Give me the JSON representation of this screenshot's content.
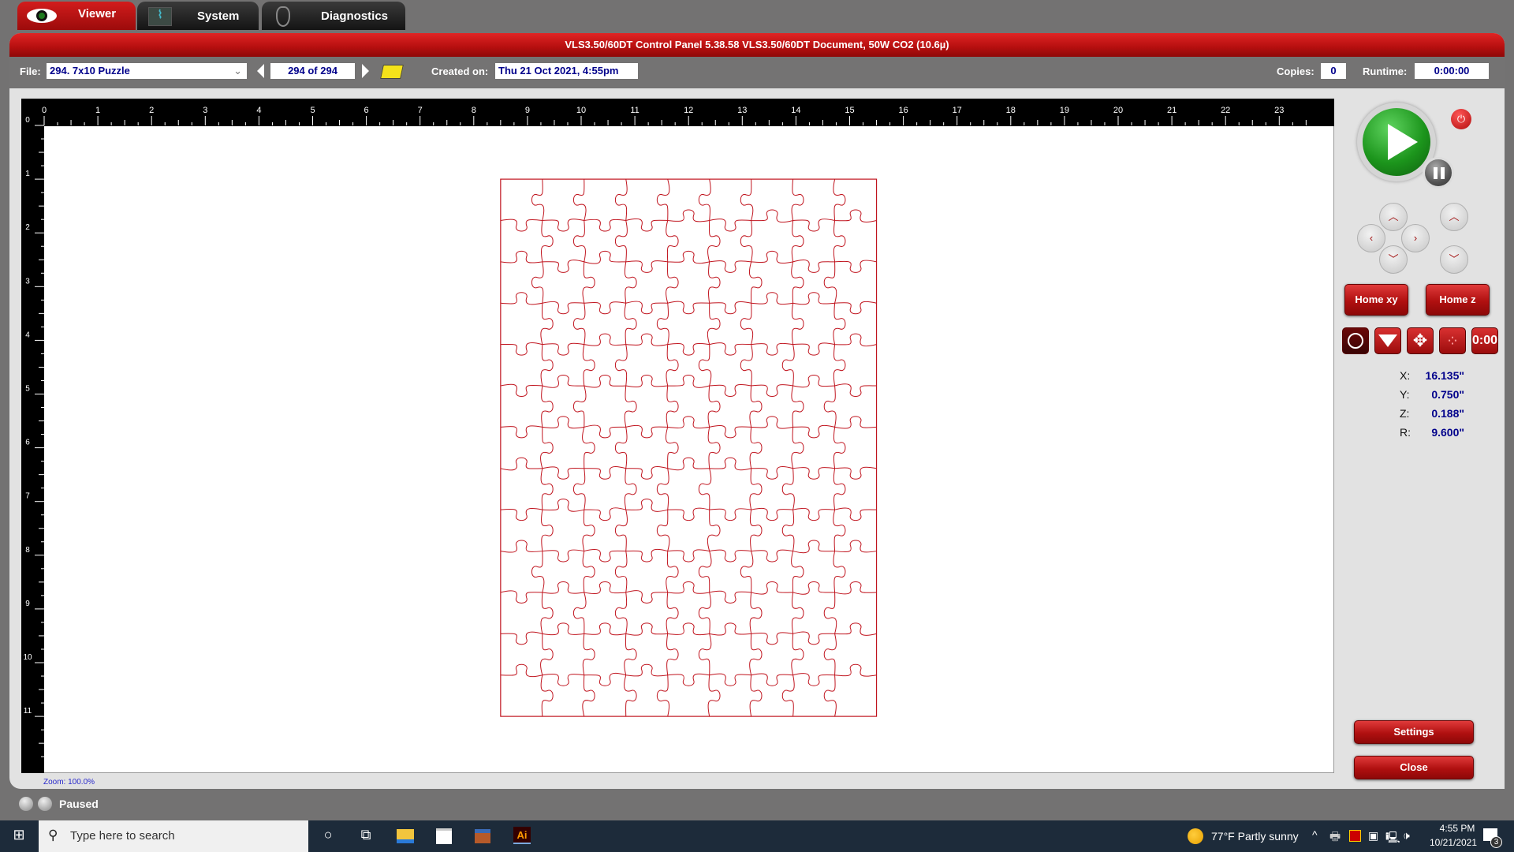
{
  "tabs": [
    {
      "label": "Viewer",
      "icon": "eye-icon",
      "active": true
    },
    {
      "label": "System",
      "icon": "waveform-icon"
    },
    {
      "label": "Diagnostics",
      "icon": "stethoscope-icon"
    }
  ],
  "title": "VLS3.50/60DT  Control Panel   5.38.58     VLS3.50/60DT Document, 50W CO2 (10.6µ)",
  "toolbar": {
    "file_label": "File:",
    "file_value": "294. 7x10 Puzzle",
    "page_value": "294 of 294",
    "created_label": "Created on:",
    "created_value": "Thu 21 Oct 2021,  4:55pm",
    "copies_label": "Copies:",
    "copies_value": "0",
    "runtime_label": "Runtime:",
    "runtime_value": "0:00:00"
  },
  "ruler": {
    "x_labels": [
      "0",
      "1",
      "2",
      "3",
      "4",
      "5",
      "6",
      "7",
      "8",
      "9",
      "10",
      "11",
      "12",
      "13",
      "14",
      "15",
      "16",
      "17",
      "18",
      "19",
      "20",
      "21",
      "22",
      "23"
    ],
    "y_labels": [
      "0",
      "1",
      "2",
      "3",
      "4",
      "5",
      "6",
      "7",
      "8",
      "9",
      "10",
      "11"
    ],
    "unit": "inch"
  },
  "document": {
    "width_in": 7,
    "height_in": 10,
    "origin_in": [
      8.5,
      1.0
    ],
    "columns": 9,
    "rows": 13,
    "line_color": "#c0141e"
  },
  "zoom_label": "Zoom:  100.0%",
  "panel": {
    "home_xy": "Home xy",
    "home_z": "Home z",
    "timer_icon_text": "0:00",
    "settings": "Settings",
    "close": "Close",
    "coords": [
      {
        "label": "X:",
        "value": "16.135\""
      },
      {
        "label": "Y:",
        "value": "0.750\""
      },
      {
        "label": "Z:",
        "value": "0.188\""
      },
      {
        "label": "R:",
        "value": "9.600\""
      }
    ]
  },
  "status": "Paused",
  "taskbar": {
    "search_placeholder": "Type here to search",
    "weather": "77°F  Partly sunny",
    "time": "4:55 PM",
    "date": "10/21/2021",
    "notifications": "3",
    "ai_label": "Ai"
  },
  "colors": {
    "accent": "#c41414",
    "play": "#1f9a1f",
    "value_text": "#00008b"
  }
}
